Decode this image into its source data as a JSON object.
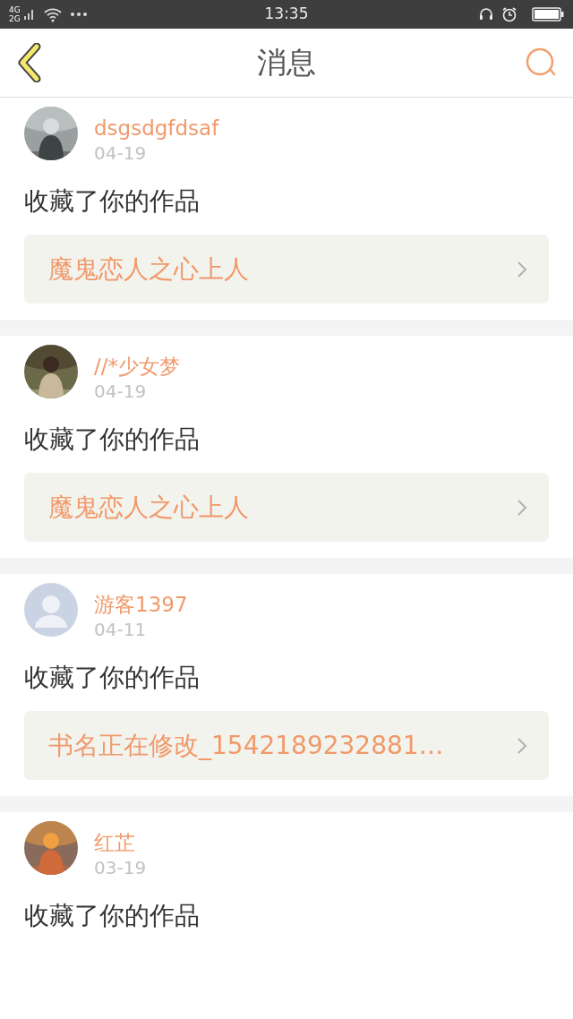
{
  "status_bar": {
    "network_top": "4G",
    "network_bottom": "2G",
    "time": "13:35"
  },
  "header": {
    "title": "消息"
  },
  "messages": [
    {
      "user": "dsgsdgfdsaf",
      "date": "04-19",
      "action": "收藏了你的作品",
      "work": "魔鬼恋人之心上人"
    },
    {
      "user": "//*少女梦",
      "date": "04-19",
      "action": "收藏了你的作品",
      "work": "魔鬼恋人之心上人"
    },
    {
      "user": "游客1397",
      "date": "04-11",
      "action": "收藏了你的作品",
      "work": "书名正在修改_1542189232881…",
      "avatar": {
        "kind": "default"
      }
    },
    {
      "user": "红芷",
      "date": "03-19",
      "action": "收藏了你的作品"
    }
  ]
}
